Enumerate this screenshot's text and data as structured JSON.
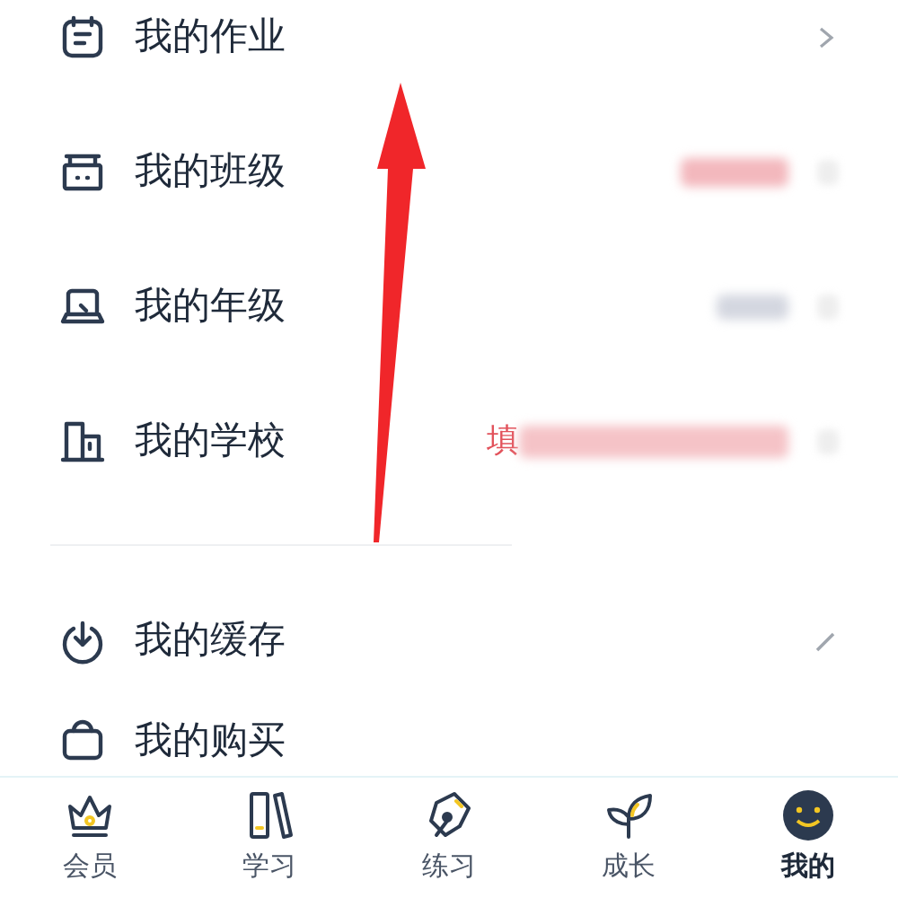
{
  "menu_group_1": [
    {
      "label": "我的作业",
      "kind": "chevron"
    },
    {
      "label": "我的班级",
      "kind": "blurred"
    },
    {
      "label": "我的年级",
      "kind": "blurred-grey"
    },
    {
      "label": "我的学校",
      "kind": "prompt",
      "prompt": "填"
    }
  ],
  "menu_group_2": [
    {
      "label": "我的缓存",
      "kind": "edit"
    },
    {
      "label": "我的购买",
      "kind": "cut"
    }
  ],
  "tab_bar": [
    {
      "label": "会员",
      "selected": false
    },
    {
      "label": "学习",
      "selected": false
    },
    {
      "label": "练习",
      "selected": false
    },
    {
      "label": "成长",
      "selected": false
    },
    {
      "label": "我的",
      "selected": true
    }
  ]
}
